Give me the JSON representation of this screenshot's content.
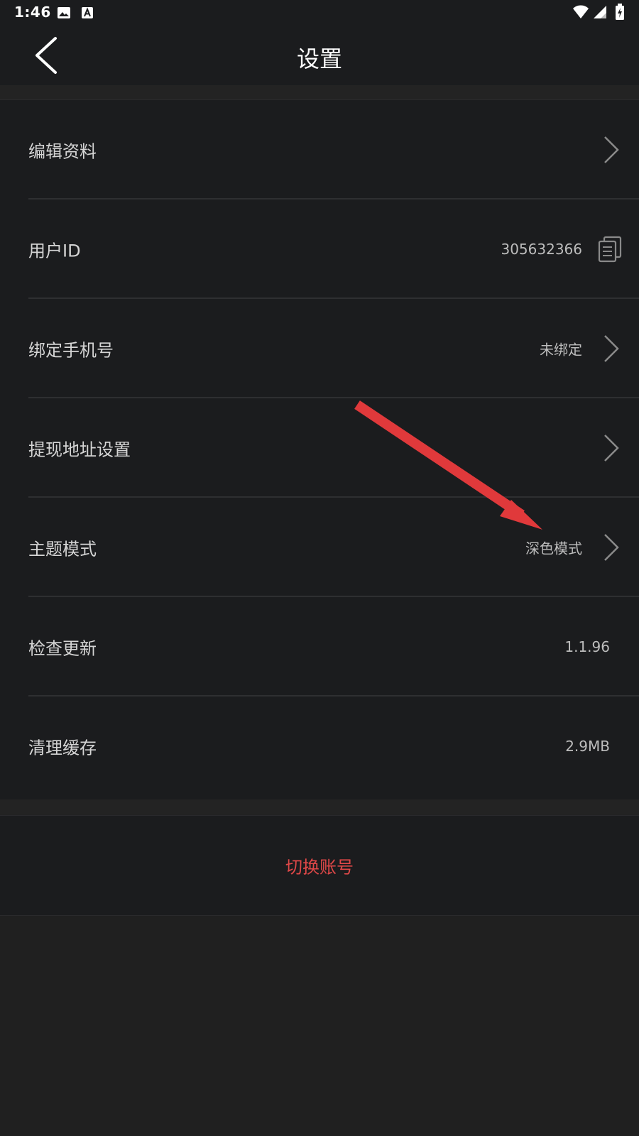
{
  "status_bar": {
    "time": "1:46",
    "icons": [
      "image-icon",
      "a-letter-icon",
      "wifi-icon",
      "signal-icon",
      "battery-charging-icon"
    ]
  },
  "header": {
    "title": "设置",
    "back_icon": "chevron-left-icon"
  },
  "settings": {
    "items": [
      {
        "label": "编辑资料",
        "value": "",
        "trailing_icon": "chevron-right-icon"
      },
      {
        "label": "用户ID",
        "value": "305632366",
        "trailing_icon": "copy-icon"
      },
      {
        "label": "绑定手机号",
        "value": "未绑定",
        "trailing_icon": "chevron-right-icon"
      },
      {
        "label": "提现地址设置",
        "value": "",
        "trailing_icon": "chevron-right-icon"
      },
      {
        "label": "主题模式",
        "value": "深色模式",
        "trailing_icon": "chevron-right-icon"
      },
      {
        "label": "检查更新",
        "value": "1.1.96"
      },
      {
        "label": "清理缓存",
        "value": "2.9MB"
      }
    ]
  },
  "switch_account": {
    "label": "切换账号",
    "color": "#e04848"
  },
  "annotation": {
    "type": "arrow",
    "color": "#e0393b",
    "points_to": "主题模式 深色模式"
  },
  "colors": {
    "background": "#1b1c1e",
    "page_bg": "#202020",
    "text_primary": "#d5d5d5",
    "text_secondary": "#bdbdbd",
    "accent_red": "#e04848"
  }
}
